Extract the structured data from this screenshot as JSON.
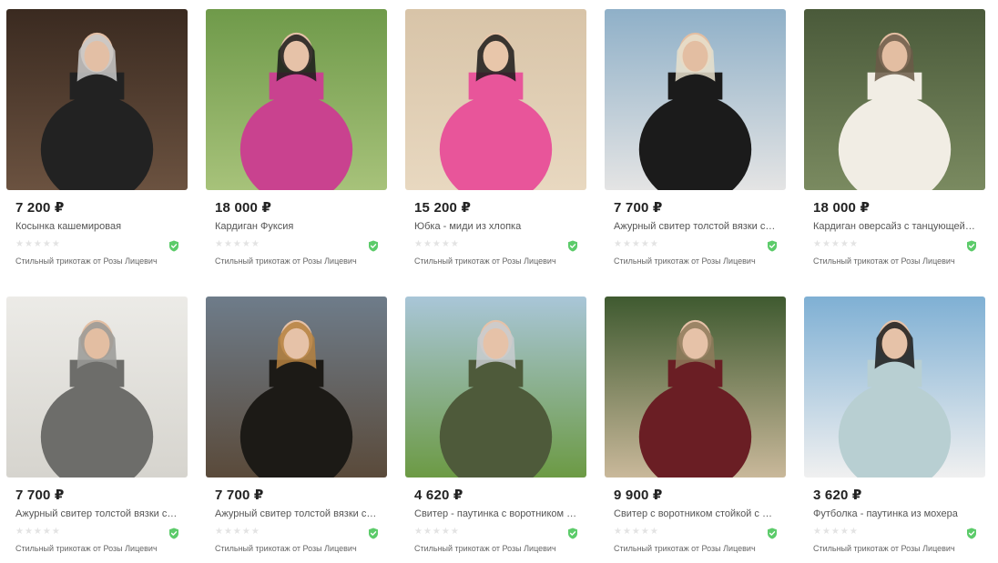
{
  "products": [
    {
      "price": "7 200 ₽",
      "title": "Косынка кашемировая",
      "rating_stars": "★★★★★",
      "seller": "Стильный трикотаж от Розы Лицевич",
      "verified_icon": "shield-check-icon",
      "scene": {
        "bg": "#3a2a20",
        "bg2": "#6b5240",
        "garment": "#222222",
        "accent": "#c9c9c9",
        "skin": "#e3bfa5"
      }
    },
    {
      "price": "18 000 ₽",
      "title": "Кардиган Фуксия",
      "rating_stars": "★★★★★",
      "seller": "Стильный трикотаж от Розы Лицевич",
      "verified_icon": "shield-check-icon",
      "scene": {
        "bg": "#6f9a4a",
        "bg2": "#a7c27a",
        "garment": "#c9428f",
        "accent": "#1a1a1a",
        "skin": "#e6c2a8"
      }
    },
    {
      "price": "15 200 ₽",
      "title": "Юбка - миди из хлопка",
      "rating_stars": "★★★★★",
      "seller": "Стильный трикотаж от Розы Лицевич",
      "verified_icon": "shield-check-icon",
      "scene": {
        "bg": "#d8c4a8",
        "bg2": "#e8d8c0",
        "garment": "#e8559a",
        "accent": "#1a1a1a",
        "skin": "#e8c6aa"
      }
    },
    {
      "price": "7 700 ₽",
      "title": "Ажурный свитер толстой вязки с открытыми плечами",
      "rating_stars": "★★★★★",
      "seller": "Стильный трикотаж от Розы Лицевич",
      "verified_icon": "shield-check-icon",
      "scene": {
        "bg": "#8fb0c8",
        "bg2": "#e4e4e4",
        "garment": "#1b1b1b",
        "accent": "#e8e0cc",
        "skin": "#e3bea2"
      }
    },
    {
      "price": "18 000 ₽",
      "title": "Кардиган оверсайз с танцующей резинкой",
      "rating_stars": "★★★★★",
      "seller": "Стильный трикотаж от Розы Лицевич",
      "verified_icon": "shield-check-icon",
      "scene": {
        "bg": "#4a5a3a",
        "bg2": "#7a8a60",
        "garment": "#f1ede4",
        "accent": "#6b5a48",
        "skin": "#e3bea2"
      }
    },
    {
      "price": "7 700 ₽",
      "title": "Ажурный свитер толстой вязки с высоким горлом",
      "rating_stars": "★★★★★",
      "seller": "Стильный трикотаж от Розы Лицевич",
      "verified_icon": "shield-check-icon",
      "scene": {
        "bg": "#ecebe7",
        "bg2": "#d6d4ce",
        "garment": "#6d6d6a",
        "accent": "#9a9a96",
        "skin": "#e3bea2"
      }
    },
    {
      "price": "7 700 ₽",
      "title": "Ажурный свитер толстой вязки с открытыми плечами",
      "rating_stars": "★★★★★",
      "seller": "Стильный трикотаж от Розы Лицевич",
      "verified_icon": "shield-check-icon",
      "scene": {
        "bg": "#6e7c8a",
        "bg2": "#5a4a3a",
        "garment": "#1c1a16",
        "accent": "#b5813f",
        "skin": "#e6c2a8"
      }
    },
    {
      "price": "4 620 ₽",
      "title": "Свитер - паутинка с воротником - стойкой",
      "rating_stars": "★★★★★",
      "seller": "Стильный трикотаж от Розы Лицевич",
      "verified_icon": "shield-check-icon",
      "scene": {
        "bg": "#a9c6d8",
        "bg2": "#6c9a44",
        "garment": "#4e5a3a",
        "accent": "#c9ccd0",
        "skin": "#e6c2a8"
      }
    },
    {
      "price": "9 900 ₽",
      "title": "Свитер с воротником стойкой с разрезами",
      "rating_stars": "★★★★★",
      "seller": "Стильный трикотаж от Розы Лицевич",
      "verified_icon": "shield-check-icon",
      "scene": {
        "bg": "#3f5a30",
        "bg2": "#c9b89a",
        "garment": "#6a1e24",
        "accent": "#8e7a5a",
        "skin": "#e6c2a8"
      }
    },
    {
      "price": "3 620 ₽",
      "title": "Футболка - паутинка из мохера",
      "rating_stars": "★★★★★",
      "seller": "Стильный трикотаж от Розы Лицевич",
      "verified_icon": "shield-check-icon",
      "scene": {
        "bg": "#7fb0d4",
        "bg2": "#f0f0f0",
        "garment": "#b8cfd2",
        "accent": "#1a1a1a",
        "skin": "#e6c2a8"
      }
    }
  ],
  "colors": {
    "verified": "#5ccb6a",
    "star_empty": "#e3e3e3",
    "price": "#222222"
  }
}
